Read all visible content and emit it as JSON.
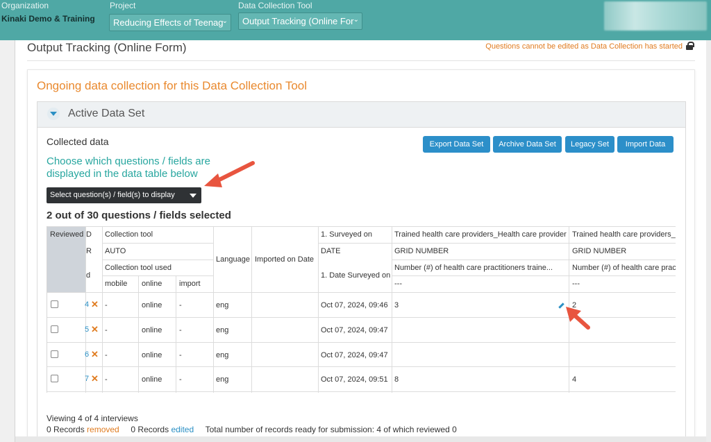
{
  "topbar": {
    "organization_label": "Organization",
    "organization_name": "Kinaki Demo & Training",
    "project_label": "Project",
    "project_value": "Reducing Effects of Teenag",
    "tool_label": "Data Collection Tool",
    "tool_value": "Output Tracking (Online For"
  },
  "page": {
    "title": "Output Tracking (Online Form)",
    "lock_note": "Questions cannot be edited as Data Collection has started",
    "ongoing_heading": "Ongoing data collection for this Data Collection Tool"
  },
  "panel": {
    "title": "Active Data Set",
    "collected_label": "Collected data",
    "choose_text": "Choose which questions / fields are displayed in the data table below",
    "fields_select_label": "Select question(s) / field(s) to display",
    "selected_count": "2 out of 30 questions / fields selected",
    "buttons": {
      "export": "Export Data Set",
      "archive": "Archive Data Set",
      "legacy": "Legacy Set",
      "import": "Import Data"
    }
  },
  "table": {
    "headers": {
      "reviewed": "Reviewed",
      "id_frag_1": "D",
      "id_frag_2": "R",
      "id_frag_3": "d",
      "collection_tool": "Collection tool",
      "auto": "AUTO",
      "collection_tool_used": "Collection tool used",
      "mobile": "mobile",
      "online": "online",
      "import": "import",
      "language": "Language",
      "imported_on": "Imported on Date",
      "surveyed_on": "1. Surveyed on",
      "date_type": "DATE",
      "date_surveyed_on": "1. Date Surveyed on",
      "q2_title": "Trained health care providers_Health care provider",
      "q2_type": "GRID NUMBER",
      "q2_desc": "Number (#) of health care practitioners traine...",
      "q2_dash": "---",
      "q3_title": "Trained health care providers_H",
      "q3_type": "GRID NUMBER",
      "q3_desc": "Number (#) of health care prac",
      "q3_dash": "---"
    },
    "rows": [
      {
        "id": "4",
        "mobile": "-",
        "online": "online",
        "import": "-",
        "language": "eng",
        "surveyed": "Oct 07, 2024, 09:46",
        "q2": "3",
        "q3": "2"
      },
      {
        "id": "5",
        "mobile": "-",
        "online": "online",
        "import": "-",
        "language": "eng",
        "surveyed": "Oct 07, 2024, 09:47",
        "q2": "",
        "q3": ""
      },
      {
        "id": "6",
        "mobile": "-",
        "online": "online",
        "import": "-",
        "language": "eng",
        "surveyed": "Oct 07, 2024, 09:47",
        "q2": "",
        "q3": ""
      },
      {
        "id": "7",
        "mobile": "-",
        "online": "online",
        "import": "-",
        "language": "eng",
        "surveyed": "Oct 07, 2024, 09:51",
        "q2": "8",
        "q3": "4"
      }
    ]
  },
  "footer": {
    "viewing": "Viewing 4 of 4 interviews",
    "removed_prefix": "0 Records",
    "removed_word": "removed",
    "edited_prefix": "0 Records",
    "edited_word": "edited",
    "total_text": "Total number of records ready for submission: 4 of which reviewed 0"
  },
  "colors": {
    "topbar": "#4fa8a5",
    "accent_orange": "#e9892e",
    "accent_teal": "#27a69f",
    "button_blue": "#2c8fc9",
    "annotation_red": "#e8553f"
  }
}
